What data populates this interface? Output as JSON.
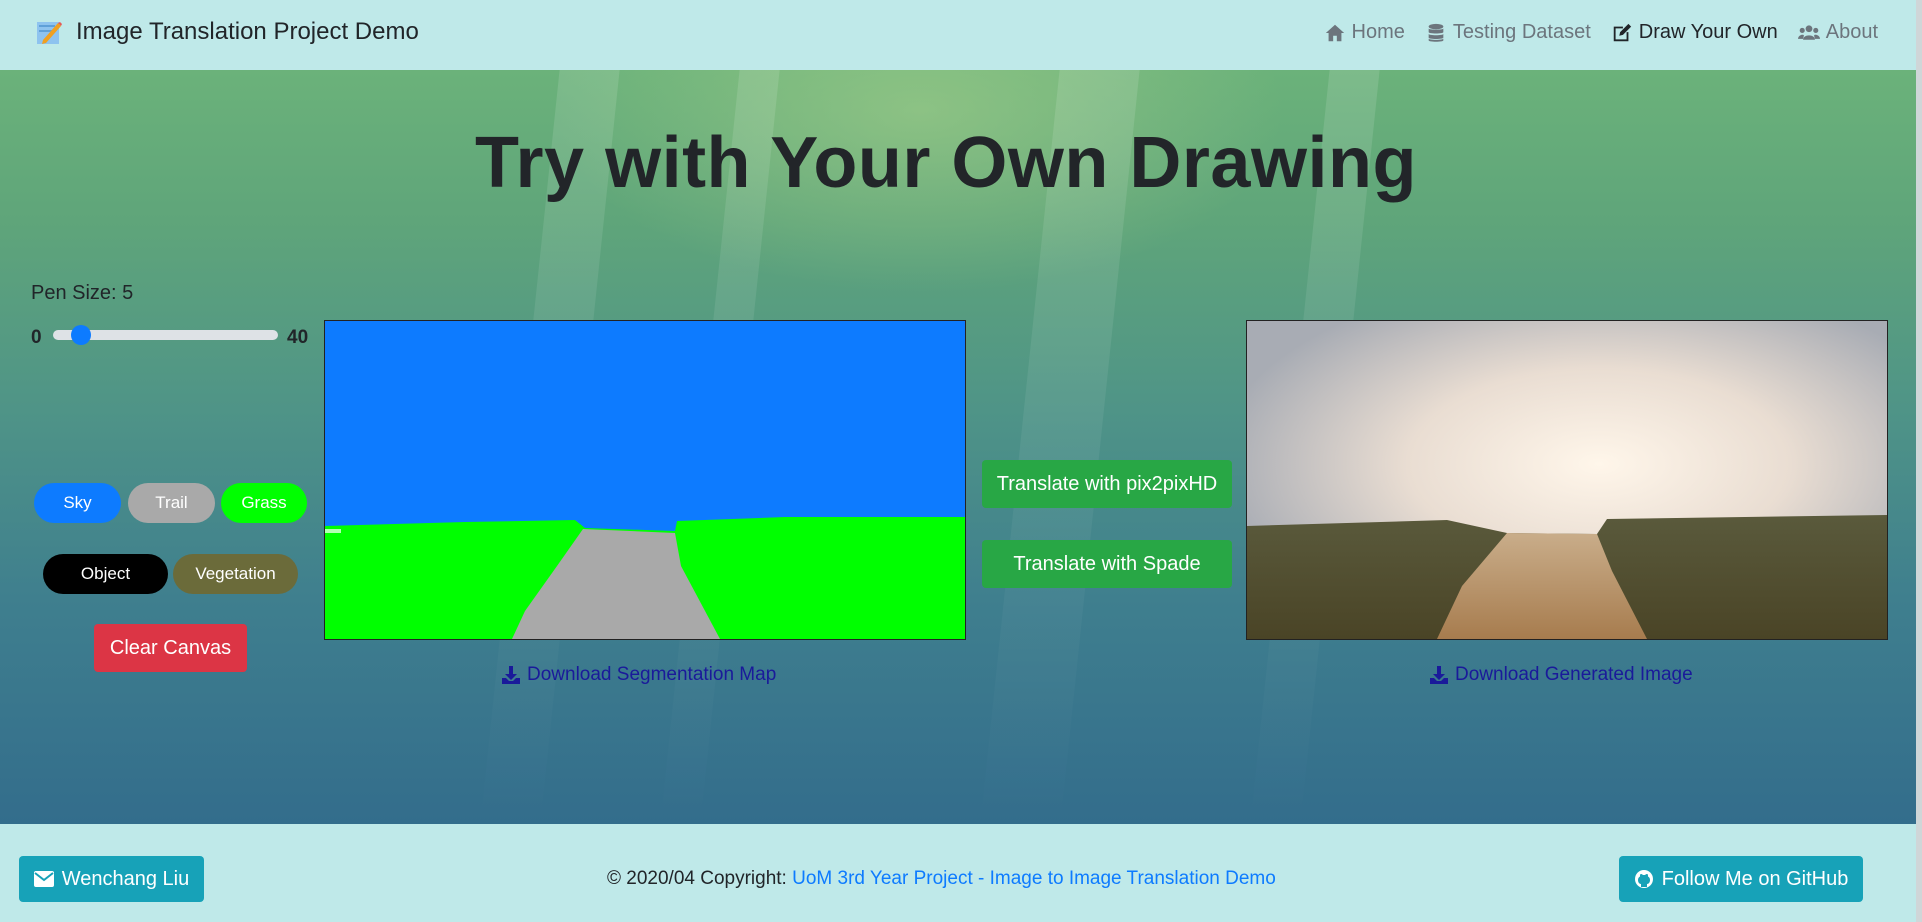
{
  "navbar": {
    "brand": "Image Translation Project Demo",
    "brand_icon": "pencil-memo-icon",
    "items": [
      {
        "label": "Home",
        "icon": "home-icon",
        "active": false
      },
      {
        "label": "Testing Dataset",
        "icon": "database-icon",
        "active": false
      },
      {
        "label": "Draw Your Own",
        "icon": "edit-icon",
        "active": true
      },
      {
        "label": "About",
        "icon": "users-icon",
        "active": false
      }
    ]
  },
  "main": {
    "title": "Try with Your Own Drawing",
    "pen": {
      "label": "Pen Size: 5",
      "min": "0",
      "max": "40",
      "value": 5
    },
    "labels": [
      {
        "text": "Sky",
        "color": "#0d7bff"
      },
      {
        "text": "Trail",
        "color": "#a9a9a9"
      },
      {
        "text": "Grass",
        "color": "#00ff00"
      },
      {
        "text": "Object",
        "color": "#000000"
      },
      {
        "text": "Vegetation",
        "color": "#6b6b3a"
      }
    ],
    "clear_label": "Clear Canvas",
    "translate_pix2pix_label": "Translate with pix2pixHD",
    "translate_spade_label": "Translate with Spade",
    "download_seg_label": "Download Segmentation Map",
    "download_gen_label": "Download Generated Image"
  },
  "footer": {
    "author_label": "Wenchang Liu",
    "copyright_prefix": "© 2020/04 Copyright:",
    "copyright_link": "UoM 3rd Year Project - Image to Image Translation Demo",
    "github_label": "Follow Me on GitHub"
  },
  "colors": {
    "navbar_bg": "#bfe9e9",
    "sky": "#0d7bff",
    "grass": "#00ff00",
    "trail": "#a9a9a9",
    "success": "#28a745",
    "danger": "#dc3545",
    "info": "#17a2b8"
  }
}
